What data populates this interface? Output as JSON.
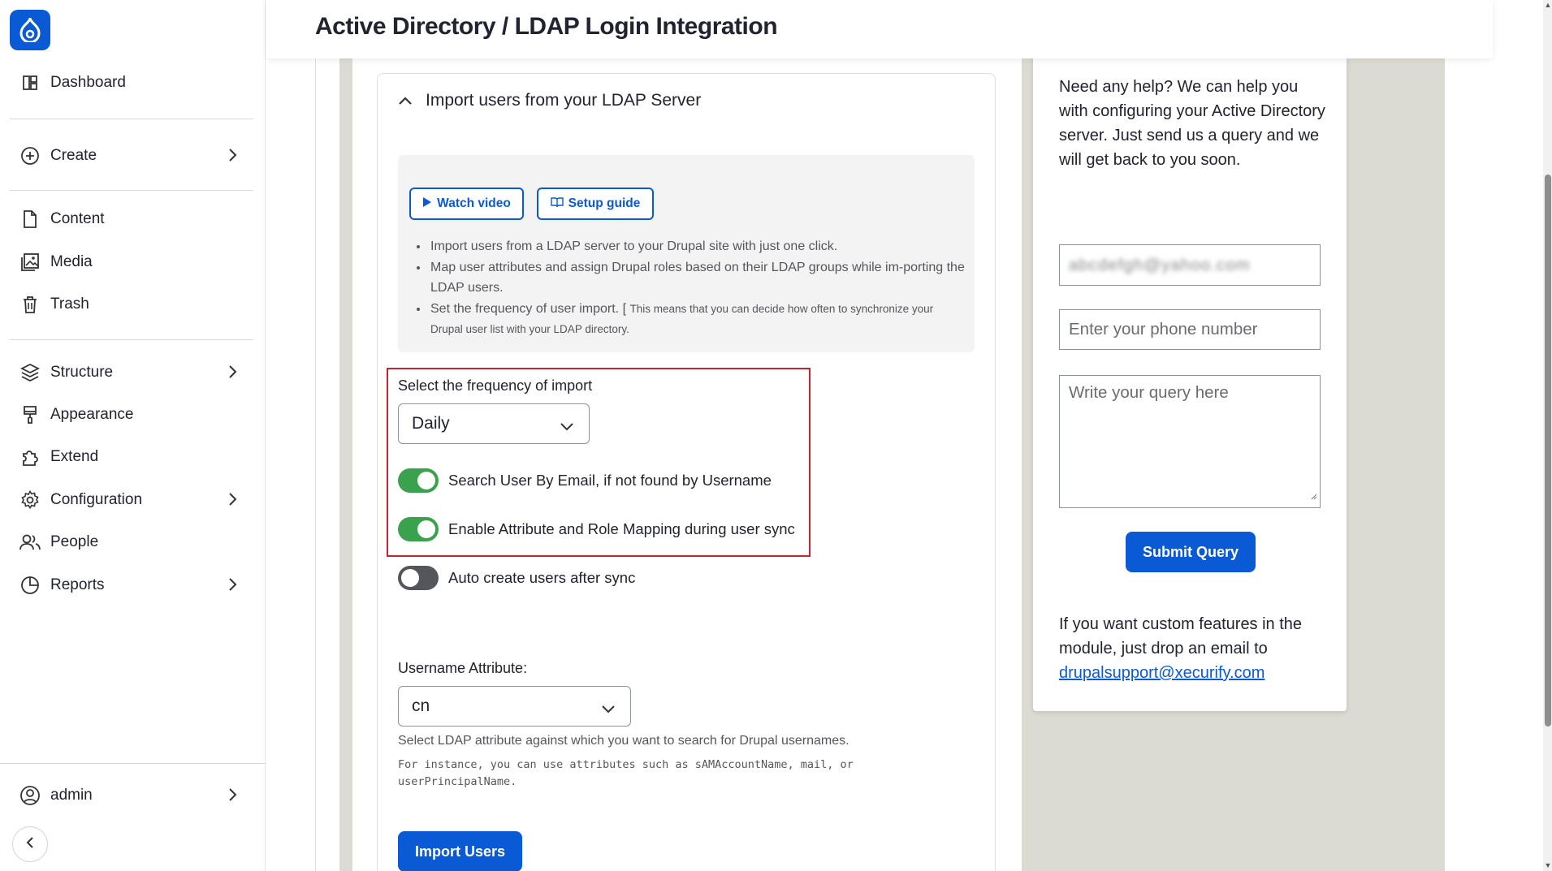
{
  "page": {
    "title": "Active Directory / LDAP Login Integration"
  },
  "sidebar": {
    "items": [
      {
        "label": "Dashboard",
        "icon": "dashboard-icon"
      },
      {
        "label": "Create",
        "icon": "plus-circle-icon"
      },
      {
        "label": "Content",
        "icon": "file-icon"
      },
      {
        "label": "Media",
        "icon": "media-icon"
      },
      {
        "label": "Trash",
        "icon": "trash-icon"
      },
      {
        "label": "Structure",
        "icon": "layers-icon"
      },
      {
        "label": "Appearance",
        "icon": "paint-brush-icon"
      },
      {
        "label": "Extend",
        "icon": "puzzle-icon"
      },
      {
        "label": "Configuration",
        "icon": "gear-icon"
      },
      {
        "label": "People",
        "icon": "people-icon"
      },
      {
        "label": "Reports",
        "icon": "chart-pie-icon"
      }
    ],
    "user": {
      "label": "admin",
      "icon": "user-circle-icon"
    }
  },
  "import_section": {
    "heading": "Import users from your LDAP Server",
    "watch_video": "Watch video",
    "setup_guide": "Setup guide",
    "bullets": {
      "b1": "Import users from a LDAP server to your Drupal site with just one click.",
      "b2": "Map user attributes and assign Drupal roles based on their LDAP groups while im-porting the LDAP users.",
      "b3_main": "Set the frequency of user import. [",
      "b3_small": "This means that you can decide how often to synchronize your Drupal user list with your LDAP directory."
    },
    "frequency_label": "Select the frequency of import",
    "frequency_value": "Daily",
    "toggles": {
      "search_by_email": {
        "label": "Search User By Email, if not found by Username",
        "on": true
      },
      "attribute_mapping": {
        "label": "Enable Attribute and Role Mapping during user sync",
        "on": true
      },
      "auto_create": {
        "label": "Auto create users after sync",
        "on": false
      }
    },
    "username_attr_label": "Username Attribute:",
    "username_attr_value": "cn",
    "username_help": "Select LDAP attribute against which you want to search for Drupal usernames.",
    "username_example": "For instance, you can use attributes such as sAMAccountName, mail, or userPrincipalName.",
    "import_button": "Import Users"
  },
  "support": {
    "intro": "Need any help? We can help you with configuring your Active Directory server. Just send us a query and we will get back to you soon.",
    "email_value": "abcdefgh@yahoo.com",
    "phone_placeholder": "Enter your phone number",
    "query_placeholder": "Write your query here",
    "submit": "Submit Query",
    "custom_text": "If you want custom features in the module, just drop an email to",
    "email_link": "drupalsupport@xecurify.com"
  },
  "colors": {
    "accent": "#0a5ad6",
    "toggle_on": "#3aa14c",
    "highlight": "#c8232e"
  }
}
